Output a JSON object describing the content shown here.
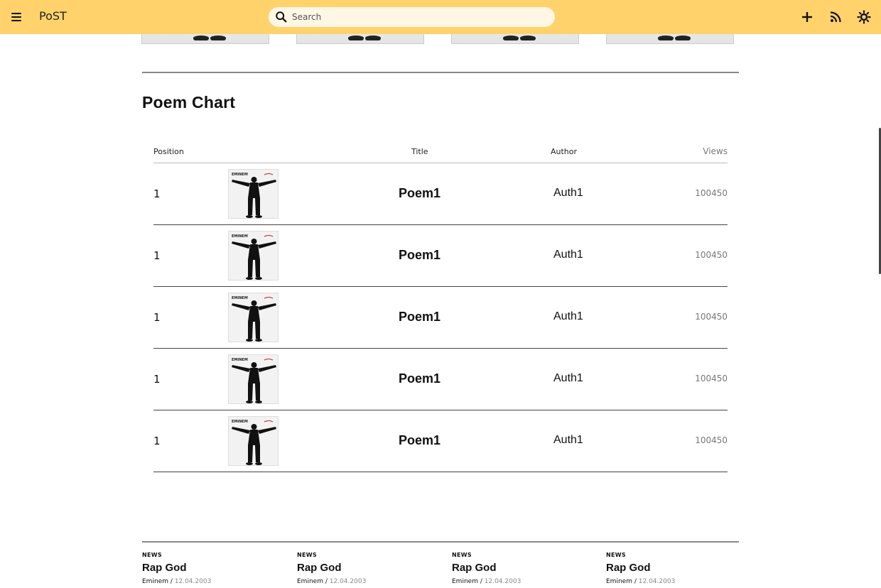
{
  "app": {
    "brand": "PoST"
  },
  "search": {
    "placeholder": "Search"
  },
  "colors": {
    "topbar": "#ffd26b",
    "divider": "#888888",
    "views_text": "#777777"
  },
  "icons": {
    "menu": "menu-icon",
    "search": "search-icon",
    "add": "plus-icon",
    "feed": "rss-icon",
    "theme": "sun-icon"
  },
  "section": {
    "title": "Poem Chart"
  },
  "table": {
    "headers": {
      "position": "Position",
      "title": "Title",
      "author": "Author",
      "views": "Views"
    },
    "rows": [
      {
        "position": "1",
        "title": "Poem1",
        "author": "Auth1",
        "views": "100450"
      },
      {
        "position": "1",
        "title": "Poem1",
        "author": "Auth1",
        "views": "100450"
      },
      {
        "position": "1",
        "title": "Poem1",
        "author": "Auth1",
        "views": "100450"
      },
      {
        "position": "1",
        "title": "Poem1",
        "author": "Auth1",
        "views": "100450"
      },
      {
        "position": "1",
        "title": "Poem1",
        "author": "Auth1",
        "views": "100450"
      }
    ]
  },
  "news": [
    {
      "category": "NEWS",
      "title": "Rap God",
      "author": "Eminem",
      "separator": "/",
      "date": "12.04.2003"
    },
    {
      "category": "NEWS",
      "title": "Rap God",
      "author": "Eminem",
      "separator": "/",
      "date": "12.04.2003"
    },
    {
      "category": "NEWS",
      "title": "Rap God",
      "author": "Eminem",
      "separator": "/",
      "date": "12.04.2003"
    },
    {
      "category": "NEWS",
      "title": "Rap God",
      "author": "Eminem",
      "separator": "/",
      "date": "12.04.2003"
    }
  ],
  "cover_art": {
    "label": "EMINEM"
  }
}
